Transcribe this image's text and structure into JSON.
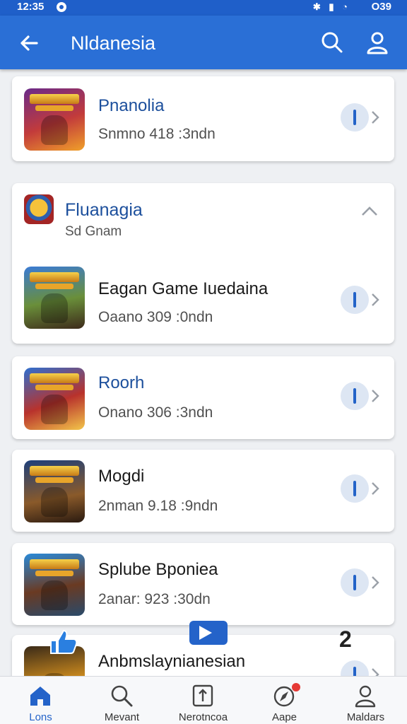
{
  "status_bar": {
    "time": "12:35",
    "battery": "O39"
  },
  "header": {
    "title": "Nldanesia"
  },
  "games": [
    {
      "name": "Pnanolia",
      "meta": "Snmno 418 :3ndn"
    },
    {
      "name": "Eagan Game Iuedaina",
      "meta": "Oaano 309 :0ndn"
    },
    {
      "name": "Roorh",
      "meta": "Onano 306 :3ndn"
    },
    {
      "name": "Mogdi",
      "meta": "2nman 9.18 :9ndn"
    },
    {
      "name": "Splube Bponiea",
      "meta": "2anar: 923 :30dn"
    },
    {
      "name": "Anbmslaynianesian",
      "meta": ""
    }
  ],
  "group": {
    "title": "Fluanagia",
    "subtitle": "Sd Gnam"
  },
  "overlay": {
    "number": "2"
  },
  "bottom_nav": [
    {
      "label": "Lons",
      "icon": "home-icon"
    },
    {
      "label": "Mevant",
      "icon": "search-icon"
    },
    {
      "label": "Nerotncoa",
      "icon": "update-icon"
    },
    {
      "label": "Aape",
      "icon": "compass-icon"
    },
    {
      "label": "Maldars",
      "icon": "person-icon"
    }
  ],
  "colors": {
    "header": "#2a6fd6",
    "accent": "#2463c9",
    "title_blue": "#1c4f9c",
    "badge": "#e53935"
  }
}
